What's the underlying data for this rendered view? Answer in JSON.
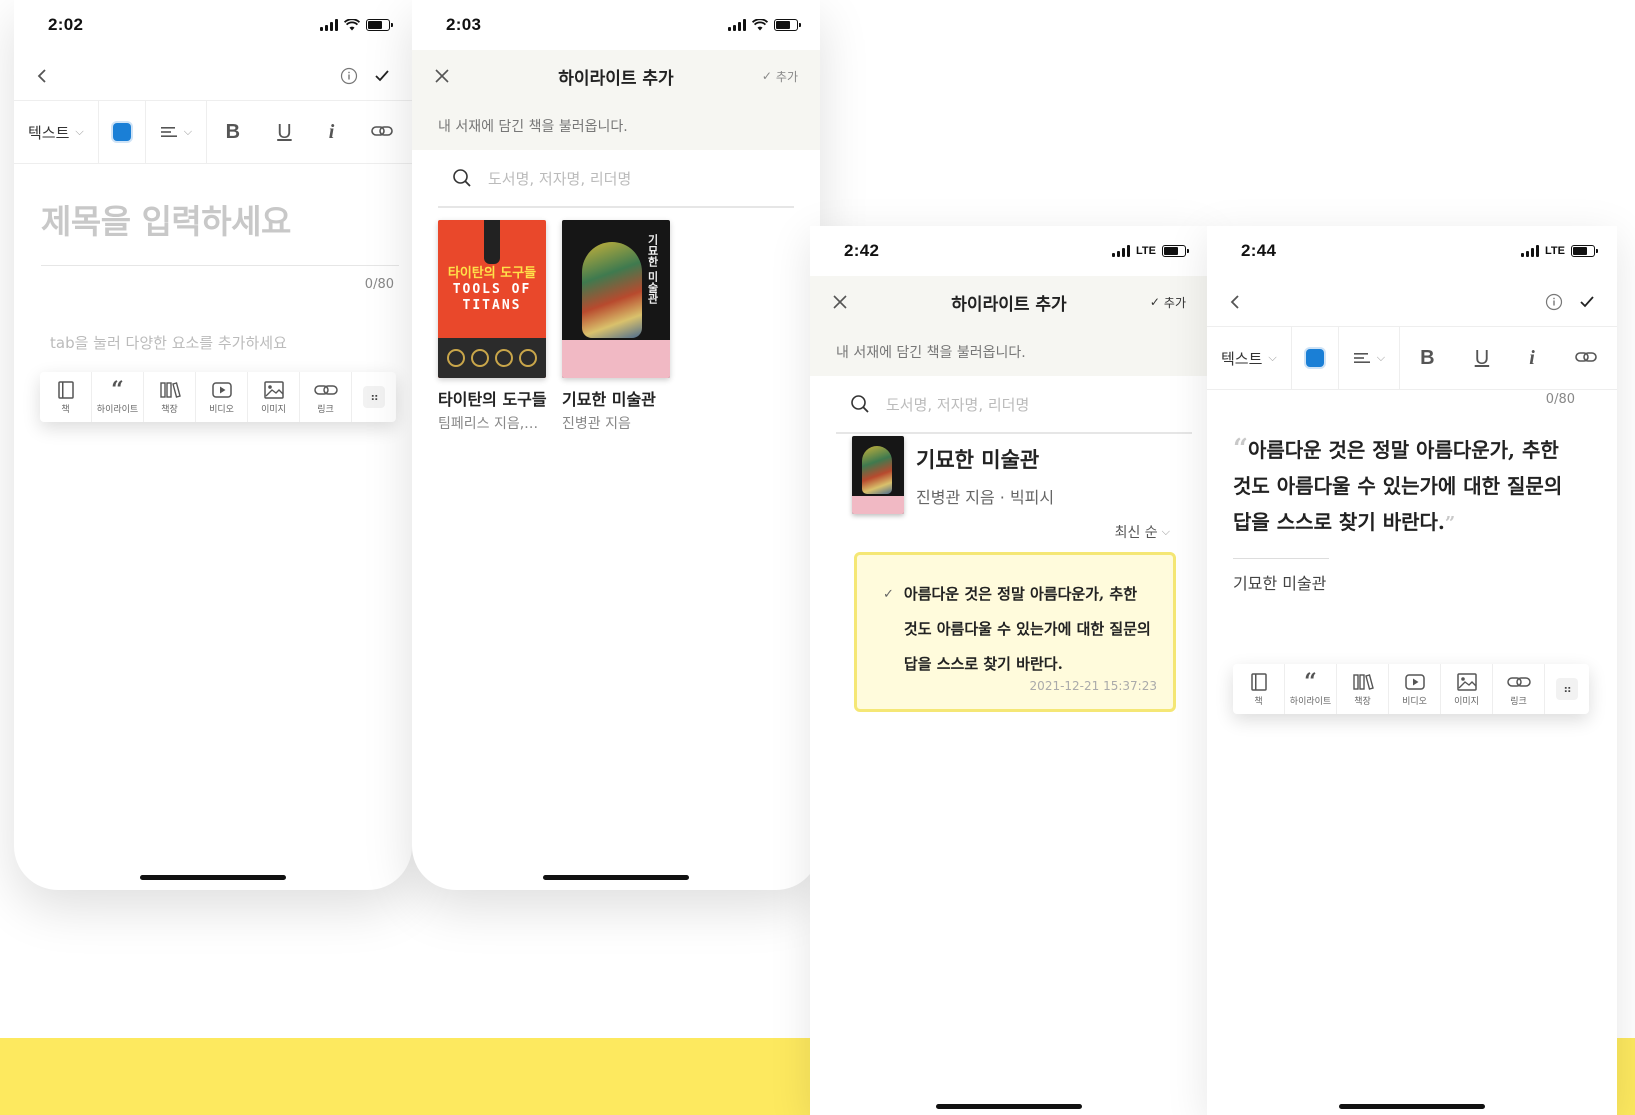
{
  "status": {
    "s1_time": "2:02",
    "s2_time": "2:03",
    "s3_time": "2:42",
    "s4_time": "2:44",
    "lte": "LTE"
  },
  "editor": {
    "text_style": "텍스트",
    "bold": "B",
    "underline": "U",
    "italic": "i",
    "title_placeholder": "제목을 입력하세요",
    "counter": "0/80",
    "body_placeholder": "tab을 눌러 다양한 요소를 추가하세요"
  },
  "elements": {
    "book": "책",
    "highlight": "하이라이트",
    "shelf": "책장",
    "video": "비디오",
    "image": "이미지",
    "link": "링크"
  },
  "modal": {
    "title": "하이라이트 추가",
    "add": "추가",
    "subtitle": "내 서재에 담긴 책을 불러옵니다.",
    "search_placeholder": "도서명, 저자명, 리더명"
  },
  "books": [
    {
      "title": "타이탄의 도구들",
      "author": "팀페리스 지음,…",
      "cover_kr": "타이탄의 도구들",
      "cover_en": "TOOLS OF TITANS"
    },
    {
      "title": "기묘한 미술관",
      "author": "진병관 지음",
      "cover_kr": "기묘한 미술관"
    }
  ],
  "selected": {
    "title": "기묘한 미술관",
    "meta": "진병관 지음 · 빅피시",
    "sort": "최신 순",
    "highlight_text": "아름다운 것은 정말 아름다운가, 추한 것도 아름다울 수 있는가에 대한 질문의 답을 스스로 찾기 바란다.",
    "timestamp": "2021-12-21 15:37:23"
  },
  "result": {
    "quote": "아름다운 것은 정말 아름다운가, 추한 것도 아름다울 수 있는가에 대한 질문의 답을 스스로 찾기 바란다.",
    "source": "기묘한 미술관",
    "counter": "0/80"
  },
  "colors": {
    "accent_yellow": "#fde95f",
    "highlight_bg": "#fffbdc",
    "highlight_border": "#f5e775",
    "swatch_blue": "#1a7fd6"
  }
}
